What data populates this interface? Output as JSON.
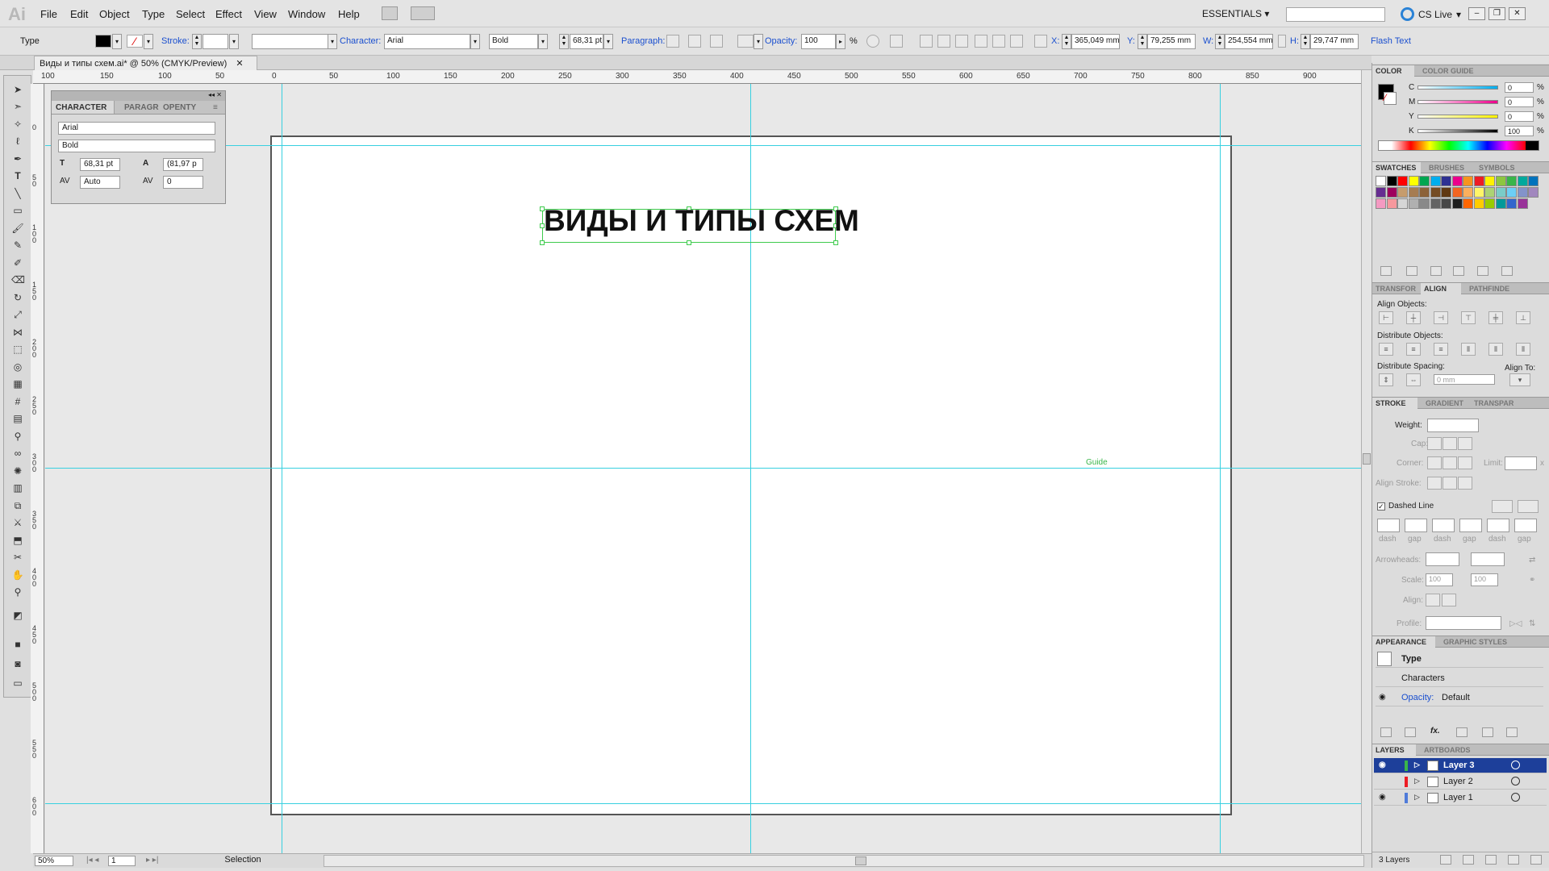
{
  "app": {
    "logo": "Ai",
    "workspace": "ESSENTIALS",
    "cslive": "CS Live"
  },
  "menu": [
    "File",
    "Edit",
    "Object",
    "Type",
    "Select",
    "Effect",
    "View",
    "Window",
    "Help"
  ],
  "menubar_icons": [
    "bridge-icon",
    "arrange-documents-icon"
  ],
  "window_buttons": [
    "minimize",
    "restore",
    "close"
  ],
  "control": {
    "tool_label": "Type",
    "stroke_label": "Stroke:",
    "character_label": "Character:",
    "font": "Arial",
    "style": "Bold",
    "size": "68,31 pt",
    "paragraph_label": "Paragraph:",
    "opacity_label": "Opacity:",
    "opacity": "100",
    "percent": "%",
    "x_label": "X:",
    "x": "365,049 mm",
    "y_label": "Y:",
    "y": "79,255 mm",
    "w_label": "W:",
    "w": "254,554 mm",
    "h_label": "H:",
    "h": "29,747 mm",
    "flash_text": "Flash Text"
  },
  "document": {
    "tab_title": "Виды и типы схем.ai* @ 50% (CMYK/Preview)"
  },
  "ruler_h": [
    "100",
    "150",
    "100",
    "50",
    "0",
    "50",
    "100",
    "150",
    "200",
    "250",
    "300",
    "350",
    "400",
    "450",
    "500",
    "550",
    "600",
    "650",
    "700",
    "750",
    "800",
    "850",
    "900"
  ],
  "ruler_v": [
    "0",
    "50",
    "100",
    "150",
    "200",
    "250",
    "300",
    "350",
    "400",
    "450",
    "500",
    "550",
    "600"
  ],
  "canvas": {
    "art_text": "ВИДЫ И ТИПЫ СХЕМ",
    "guide_label": "Guide"
  },
  "character_panel": {
    "tabs": [
      "CHARACTER",
      "PARAGR",
      "OPENTY"
    ],
    "font": "Arial",
    "style": "Bold",
    "size": "68,31 pt",
    "leading": "(81,97 p",
    "kerning": "Auto",
    "tracking": "0"
  },
  "status": {
    "zoom": "50%",
    "artboard": "1",
    "tool": "Selection"
  },
  "color_panel": {
    "tabs": [
      "COLOR",
      "COLOR GUIDE"
    ],
    "channels": [
      {
        "name": "C",
        "value": "0"
      },
      {
        "name": "M",
        "value": "0"
      },
      {
        "name": "Y",
        "value": "0"
      },
      {
        "name": "K",
        "value": "100"
      }
    ],
    "percent": "%"
  },
  "swatches_panel": {
    "tabs": [
      "SWATCHES",
      "BRUSHES",
      "SYMBOLS"
    ],
    "colors": [
      "#ffffff",
      "#000000",
      "#ff0000",
      "#ffff00",
      "#00a651",
      "#00aeef",
      "#2e3192",
      "#ec008c",
      "#f7941d",
      "#ed1c24",
      "#fff200",
      "#8dc63f",
      "#39b54a",
      "#00a99d",
      "#0072bc",
      "#662d91",
      "#9e005d",
      "#c69c6d",
      "#a67c52",
      "#8c6239",
      "#754c24",
      "#603913",
      "#f26522",
      "#fbaf5d",
      "#fff568",
      "#acd373",
      "#7accc8",
      "#6dcff6",
      "#8393ca",
      "#a187be",
      "#f49ac2",
      "#f6989d",
      "#d6d6d6",
      "#b0b0b0",
      "#898989",
      "#636363",
      "#464646",
      "#1f1f1f",
      "#ff6600",
      "#ffcc00",
      "#99cc00",
      "#009999",
      "#3366cc",
      "#993399"
    ]
  },
  "align_panel": {
    "tabs": [
      "TRANSFOR",
      "ALIGN",
      "PATHFINDE"
    ],
    "align_objects": "Align Objects:",
    "distribute_objects": "Distribute Objects:",
    "distribute_spacing": "Distribute Spacing:",
    "align_to": "Align To:",
    "spacing_value": "0 mm"
  },
  "stroke_panel": {
    "tabs": [
      "STROKE",
      "GRADIENT",
      "TRANSPAR"
    ],
    "weight": "Weight:",
    "cap": "Cap:",
    "corner": "Corner:",
    "limit": "Limit:",
    "limit_x": "x",
    "align_stroke": "Align Stroke:",
    "dashed": "Dashed Line",
    "dash_labels": [
      "dash",
      "gap",
      "dash",
      "gap",
      "dash",
      "gap"
    ],
    "arrowheads": "Arrowheads:",
    "scale": "Scale:",
    "scale1": "100",
    "scale2": "100",
    "align": "Align:",
    "profile": "Profile:"
  },
  "appearance_panel": {
    "tabs": [
      "APPEARANCE",
      "GRAPHIC STYLES"
    ],
    "type": "Type",
    "characters": "Characters",
    "opacity_label": "Opacity:",
    "opacity_value": "Default"
  },
  "layers_panel": {
    "tabs": [
      "LAYERS",
      "ARTBOARDS"
    ],
    "layers": [
      {
        "name": "Layer 3",
        "color": "#39b54a"
      },
      {
        "name": "Layer 2",
        "color": "#ed1c24"
      },
      {
        "name": "Layer 1",
        "color": "#4f7bd9"
      }
    ],
    "count": "3 Layers"
  }
}
